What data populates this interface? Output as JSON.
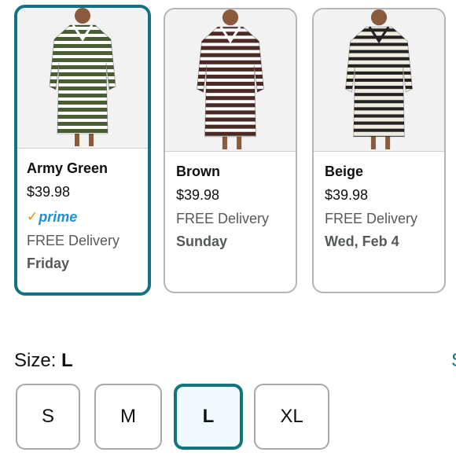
{
  "variants": [
    {
      "color": "Army Green",
      "price": "$39.98",
      "prime": "prime",
      "delivery": "FREE Delivery",
      "day": "Friday",
      "swatch": "#4a5e34",
      "stripe": "#ffffff",
      "selected": true
    },
    {
      "color": "Brown",
      "price": "$39.98",
      "delivery": "FREE Delivery",
      "day": "Sunday",
      "swatch": "#4a2a22",
      "stripe": "#ffffff",
      "selected": false
    },
    {
      "color": "Beige",
      "price": "$39.98",
      "delivery": "FREE Delivery",
      "day": "Wed, Feb 4",
      "swatch": "#f1ece0",
      "stripe": "#222222",
      "selected": false
    }
  ],
  "size": {
    "label": "Size:",
    "value": "L",
    "options": [
      "S",
      "M",
      "L",
      "XL"
    ],
    "selected": "L",
    "edge_text": "S"
  },
  "colors": {
    "accent": "#127381",
    "prime_blue": "#1f8fd6",
    "prime_check": "#f08804"
  }
}
